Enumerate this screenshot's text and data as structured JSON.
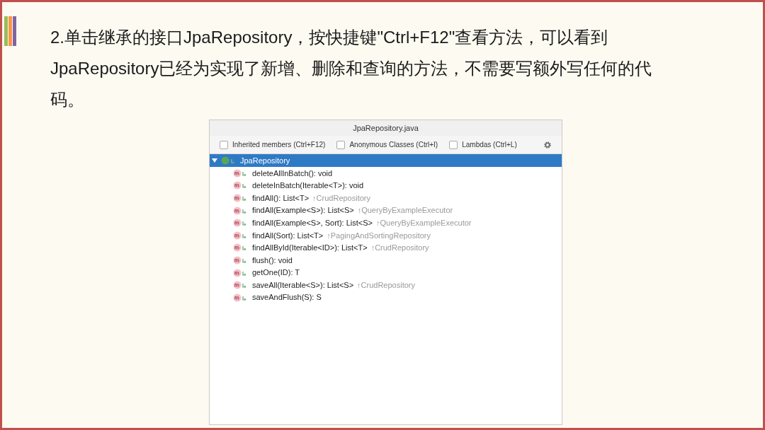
{
  "slide": {
    "text": "2.单击继承的接口JpaRepository，按快捷键\"Ctrl+F12\"查看方法，可以看到JpaRepository已经为实现了新增、删除和查询的方法，不需要写额外写任何的代码。"
  },
  "dialog": {
    "title": "JpaRepository.java",
    "options": [
      {
        "label": "Inherited members (Ctrl+F12)",
        "checked": false
      },
      {
        "label": "Anonymous Classes (Ctrl+I)",
        "checked": false
      },
      {
        "label": "Lambdas (Ctrl+L)",
        "checked": false
      }
    ],
    "root": {
      "label": "JpaRepository",
      "expanded": true,
      "selected": true,
      "children": [
        {
          "signature": "deleteAllInBatch(): void"
        },
        {
          "signature": "deleteInBatch(Iterable<T>): void"
        },
        {
          "signature": "findAll(): List<T>",
          "inherited_from": "↑CrudRepository"
        },
        {
          "signature": "findAll(Example<S>): List<S>",
          "inherited_from": "↑QueryByExampleExecutor"
        },
        {
          "signature": "findAll(Example<S>, Sort): List<S>",
          "inherited_from": "↑QueryByExampleExecutor"
        },
        {
          "signature": "findAll(Sort): List<T>",
          "inherited_from": "↑PagingAndSortingRepository"
        },
        {
          "signature": "findAllById(Iterable<ID>): List<T>",
          "inherited_from": "↑CrudRepository"
        },
        {
          "signature": "flush(): void"
        },
        {
          "signature": "getOne(ID): T"
        },
        {
          "signature": "saveAll(Iterable<S>): List<S>",
          "inherited_from": "↑CrudRepository"
        },
        {
          "signature": "saveAndFlush(S): S"
        }
      ]
    }
  }
}
